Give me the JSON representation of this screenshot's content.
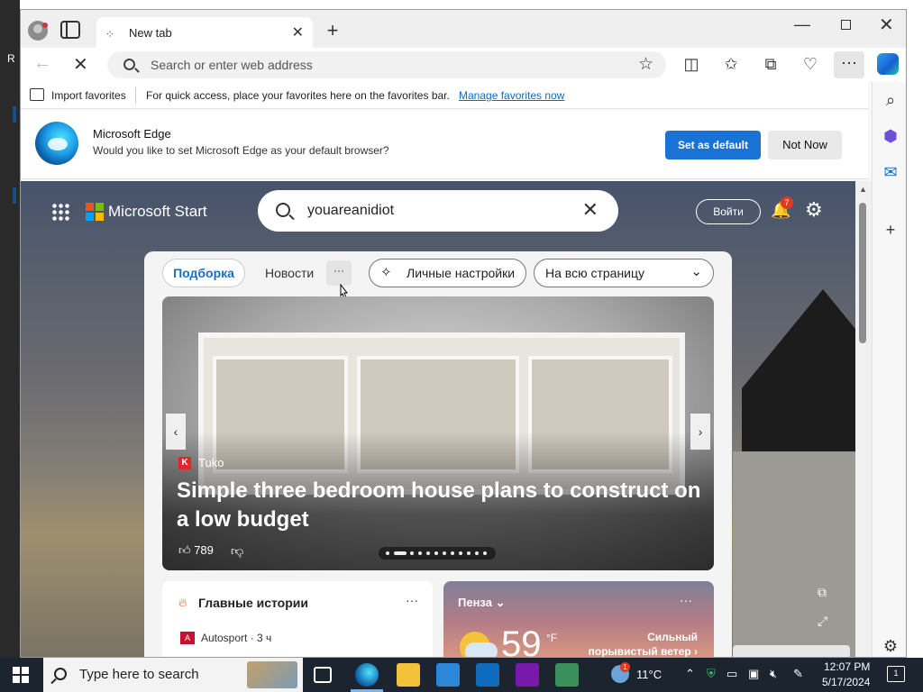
{
  "desktop": {
    "letter": "R"
  },
  "tab": {
    "title": "New tab"
  },
  "address": {
    "placeholder": "Search or enter web address"
  },
  "favorites_bar": {
    "import_label": "Import favorites",
    "hint": "For quick access, place your favorites here on the favorites bar.",
    "manage_link": "Manage favorites now"
  },
  "infobar": {
    "title": "Microsoft Edge",
    "text": "Would you like to set Microsoft Edge as your default browser?",
    "set_default": "Set as default",
    "not_now": "Not Now"
  },
  "start_page": {
    "brand": "Microsoft Start",
    "search_value": "youareanidiot",
    "login": "Войти",
    "notifications_count": "7",
    "tabs": {
      "active": "Подборка",
      "news": "Новости",
      "more": "···"
    },
    "personalize": "Личные настройки",
    "layout_select": "На всю страницу",
    "hero": {
      "source": "Tuko",
      "source_logo": "K",
      "title": "Simple three bedroom house plans to construct on a low budget",
      "likes": "789",
      "slide_count": 12,
      "active_slide": 2
    },
    "top_stories": {
      "title": "Главные истории",
      "source": "Autosport · 3 ч",
      "source_logo": "A"
    },
    "weather": {
      "city": "Пенза",
      "temp": "59",
      "unit": "°F",
      "wind_line1": "Сильный",
      "wind_line2": "порывистый ветер ›"
    }
  },
  "taskbar": {
    "search_text": "Type here to search",
    "temperature": "11°C",
    "tray_badge": "1",
    "time": "12:07 PM",
    "date": "5/17/2024",
    "notifications_count": "1"
  },
  "colors": {
    "accent": "#1a73d4",
    "brand_red": "#f25022",
    "brand_green": "#7fba00",
    "brand_blue": "#00a4ef",
    "brand_yellow": "#ffb900"
  }
}
